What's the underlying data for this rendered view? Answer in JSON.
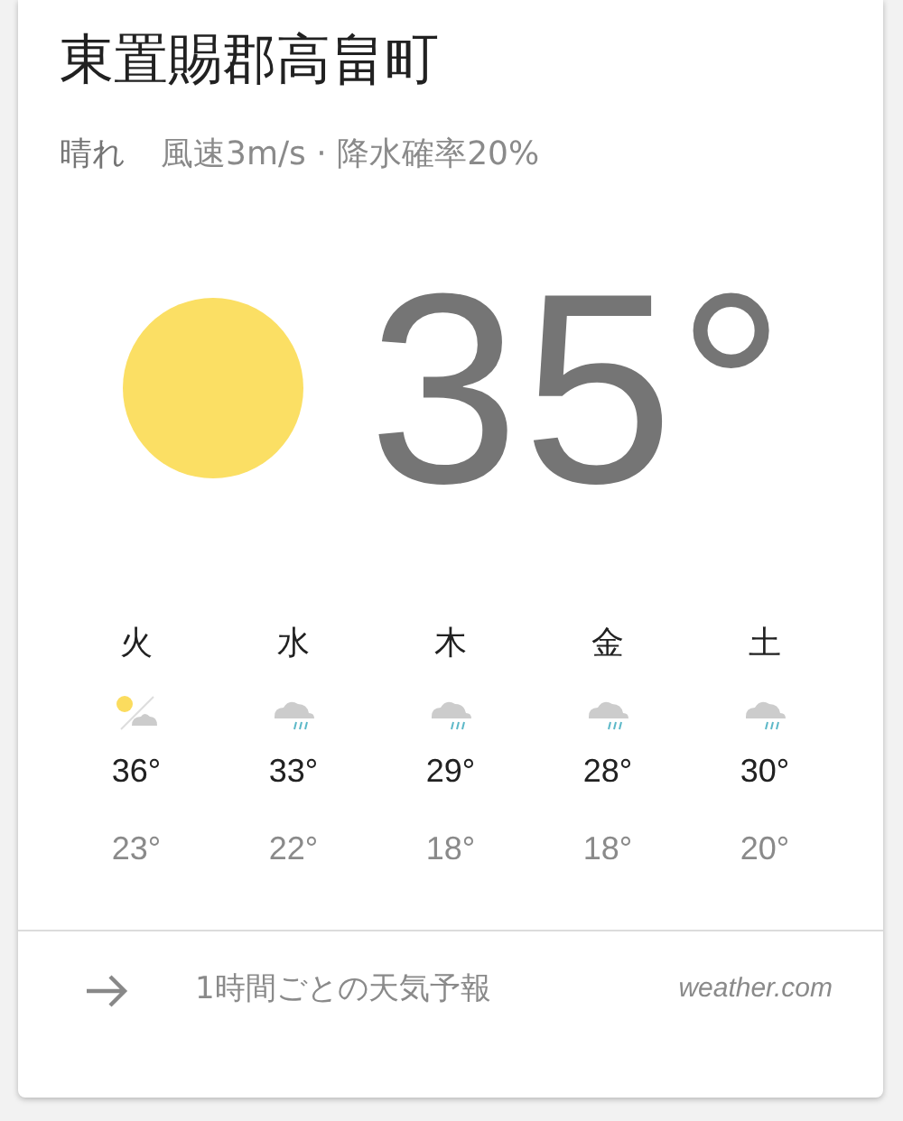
{
  "location": "東置賜郡高畠町",
  "condition": "晴れ",
  "details": "風速3m/s · 降水確率20%",
  "temperature": "35°",
  "forecast": [
    {
      "day": "火",
      "kind": "partly-sunny",
      "high": "36°",
      "low": "23°"
    },
    {
      "day": "水",
      "kind": "rain",
      "high": "33°",
      "low": "22°"
    },
    {
      "day": "木",
      "kind": "rain",
      "high": "29°",
      "low": "18°"
    },
    {
      "day": "金",
      "kind": "rain",
      "high": "28°",
      "low": "18°"
    },
    {
      "day": "土",
      "kind": "rain",
      "high": "30°",
      "low": "20°"
    }
  ],
  "footer": {
    "link": "1時間ごとの天気予報",
    "source": "weather.com"
  }
}
